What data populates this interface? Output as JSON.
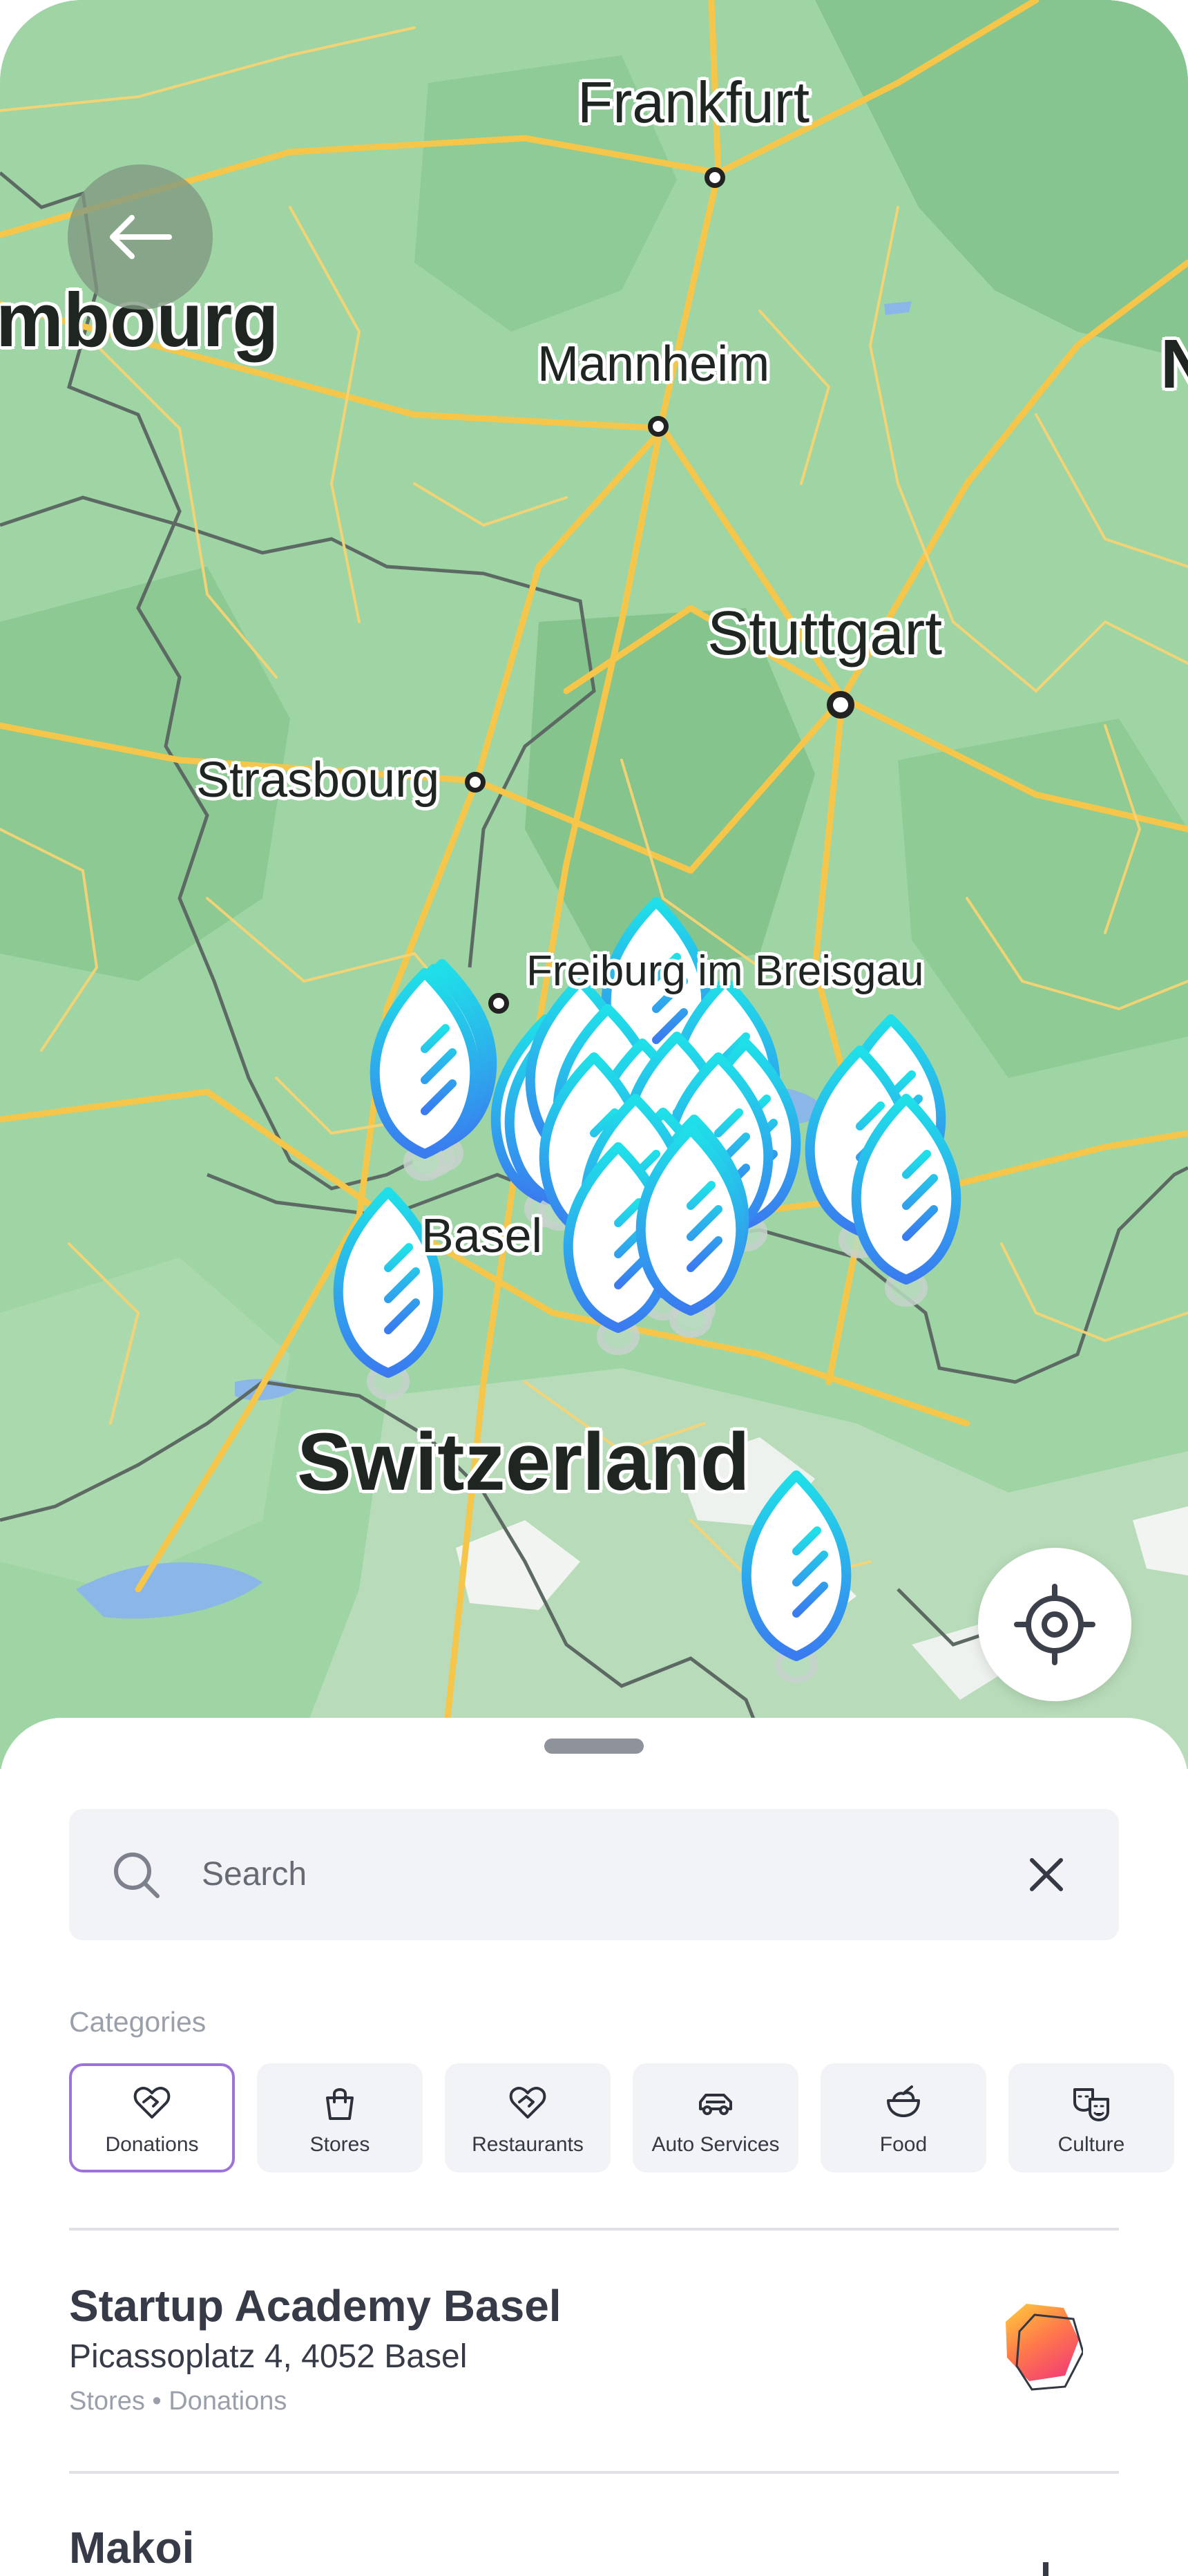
{
  "map": {
    "cities": {
      "frankfurt": "Frankfurt",
      "luxembourg": "mbourg",
      "mannheim": "Mannheim",
      "stuttgart": "Stuttgart",
      "strasbourg": "Strasbourg",
      "freiburg": "Freiburg im Breisgau",
      "basel": "Basel",
      "switzerland": "Switzerland",
      "edge_right": "N"
    },
    "pin_icon": "leaf-marker-icon",
    "back_icon": "arrow-left-icon",
    "locate_icon": "crosshair-icon"
  },
  "sheet": {
    "search": {
      "placeholder": "Search",
      "search_icon": "search-icon",
      "clear_icon": "close-icon"
    },
    "categories_title": "Categories",
    "categories": [
      {
        "label": "Donations",
        "icon": "heart-handshake-icon",
        "selected": true
      },
      {
        "label": "Stores",
        "icon": "shopping-bag-icon",
        "selected": false
      },
      {
        "label": "Restaurants",
        "icon": "heart-handshake-icon",
        "selected": false
      },
      {
        "label": "Auto Services",
        "icon": "car-icon",
        "selected": false
      },
      {
        "label": "Food",
        "icon": "bowl-icon",
        "selected": false
      },
      {
        "label": "Culture",
        "icon": "theater-masks-icon",
        "selected": false
      }
    ],
    "places": [
      {
        "name": "Startup Academy Basel",
        "address": "Picassoplatz 4, 4052 Basel",
        "categories": "Stores • Donations"
      },
      {
        "name": "Makoi"
      }
    ]
  },
  "colors": {
    "accent": "#9b73d9",
    "pin_top": "#1fe0e8",
    "pin_bottom": "#3a7bf0",
    "map_base": "#9fd5a4",
    "road": "#f6c64a"
  }
}
